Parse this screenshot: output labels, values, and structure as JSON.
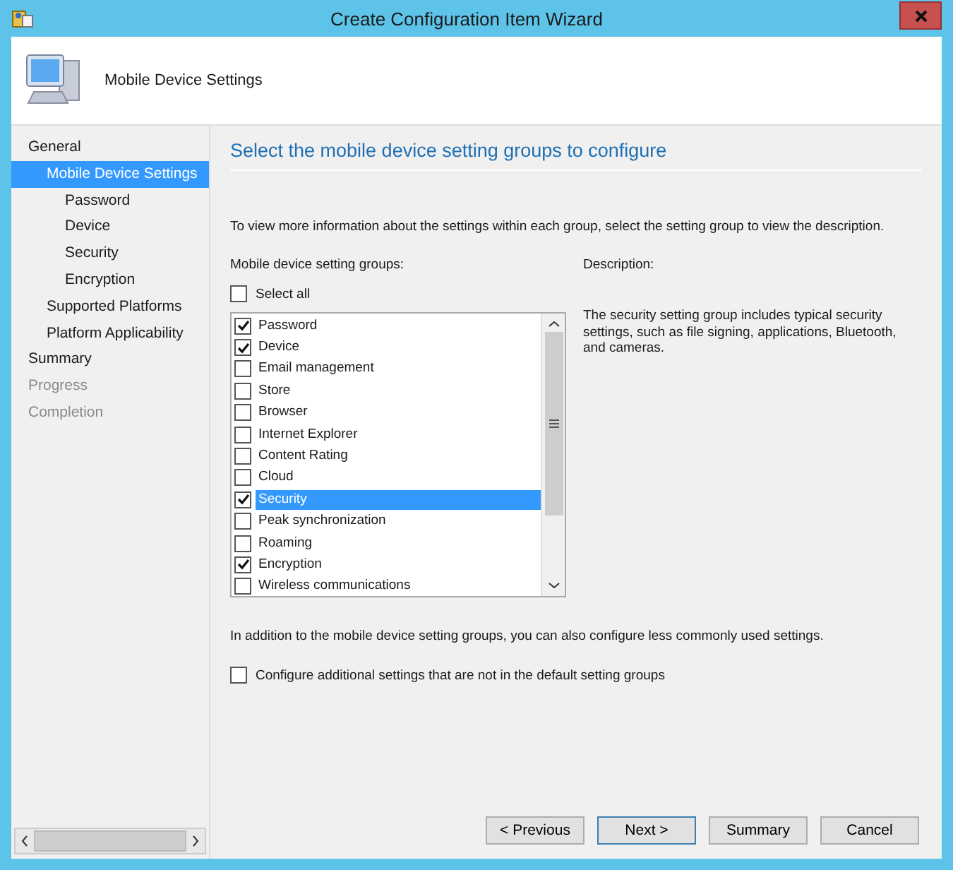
{
  "window": {
    "title": "Create Configuration Item Wizard"
  },
  "header": {
    "title": "Mobile Device Settings"
  },
  "nav": [
    {
      "label": "General",
      "selected": false,
      "disabled": false,
      "children": [
        {
          "label": "Mobile Device Settings",
          "selected": true,
          "disabled": false,
          "children": [
            {
              "label": "Password",
              "selected": false,
              "disabled": false
            },
            {
              "label": "Device",
              "selected": false,
              "disabled": false
            },
            {
              "label": "Security",
              "selected": false,
              "disabled": false
            },
            {
              "label": "Encryption",
              "selected": false,
              "disabled": false
            }
          ]
        },
        {
          "label": "Supported Platforms",
          "selected": false,
          "disabled": false
        },
        {
          "label": "Platform Applicability",
          "selected": false,
          "disabled": false
        }
      ]
    },
    {
      "label": "Summary",
      "selected": false,
      "disabled": false
    },
    {
      "label": "Progress",
      "selected": false,
      "disabled": true
    },
    {
      "label": "Completion",
      "selected": false,
      "disabled": true
    }
  ],
  "page": {
    "heading": "Select the mobile device setting groups to configure",
    "intro": "To view more information about the settings within each group, select the setting group to view the description.",
    "groups_label": "Mobile device setting groups:",
    "description_label": "Description:",
    "select_all": {
      "label": "Select all",
      "checked": false
    },
    "groups": [
      {
        "label": "Password",
        "checked": true,
        "selected": false
      },
      {
        "label": "Device",
        "checked": true,
        "selected": false
      },
      {
        "label": "Email management",
        "checked": false,
        "selected": false
      },
      {
        "label": "Store",
        "checked": false,
        "selected": false
      },
      {
        "label": "Browser",
        "checked": false,
        "selected": false
      },
      {
        "label": "Internet Explorer",
        "checked": false,
        "selected": false
      },
      {
        "label": "Content Rating",
        "checked": false,
        "selected": false
      },
      {
        "label": "Cloud",
        "checked": false,
        "selected": false
      },
      {
        "label": "Security",
        "checked": true,
        "selected": true
      },
      {
        "label": "Peak synchronization",
        "checked": false,
        "selected": false
      },
      {
        "label": "Roaming",
        "checked": false,
        "selected": false
      },
      {
        "label": "Encryption",
        "checked": true,
        "selected": false
      },
      {
        "label": "Wireless communications",
        "checked": false,
        "selected": false
      }
    ],
    "description": "The security setting group includes typical security settings, such as file signing, applications, Bluetooth, and cameras.",
    "additional_note": "In addition to the mobile device setting groups, you can also configure less commonly used settings.",
    "additional": {
      "label": "Configure additional settings that are not in the default setting groups",
      "checked": false
    }
  },
  "buttons": [
    {
      "label": "< Previous",
      "default": false
    },
    {
      "label": "Next >",
      "default": true
    },
    {
      "label": "Summary",
      "default": false
    },
    {
      "label": "Cancel",
      "default": false
    }
  ]
}
